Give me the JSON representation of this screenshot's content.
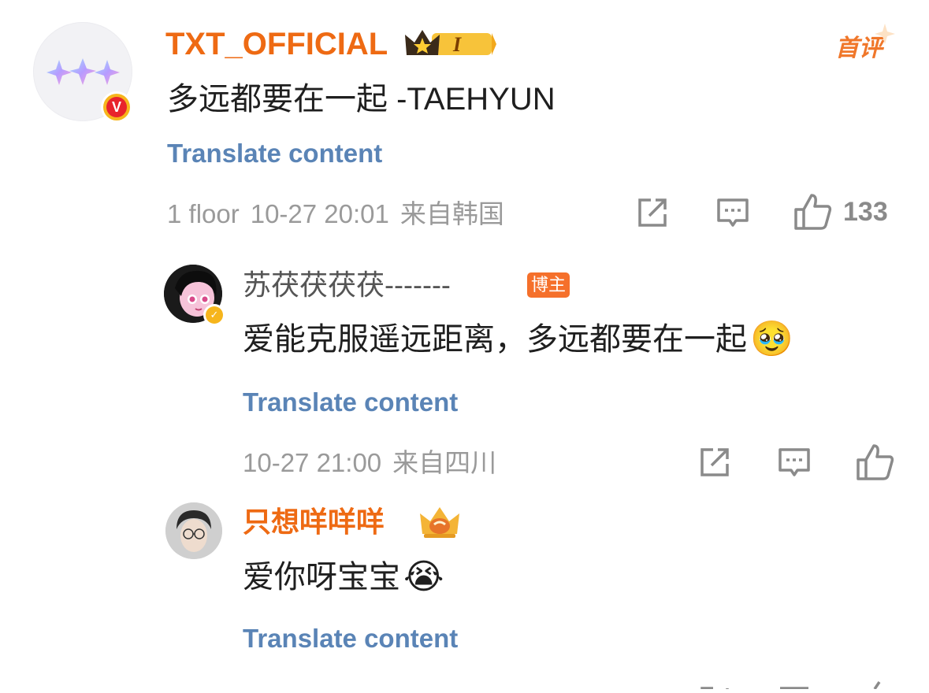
{
  "main_comment": {
    "username": "TXT_OFFICIAL",
    "level_badge": "I",
    "top_tag": "首评",
    "content": "多远都要在一起 -TAEHYUN",
    "translate_label": "Translate content",
    "floor": "1 floor",
    "timestamp": "10-27 20:01",
    "location": "来自韩国",
    "like_count": "133",
    "verified_icon": "v-badge-icon",
    "accent_color": "#ee6a13"
  },
  "replies": [
    {
      "username": "苏茯茯茯茯-------",
      "tag": "博主",
      "content": "爱能克服遥远距离，多远都要在一起",
      "emoji": "🥹",
      "translate_label": "Translate content",
      "timestamp": "10-27 21:00",
      "location": "来自四川"
    },
    {
      "username": "只想咩咩咩",
      "content": "爱你呀宝宝",
      "emoji": "😭",
      "translate_label": "Translate content"
    }
  ]
}
